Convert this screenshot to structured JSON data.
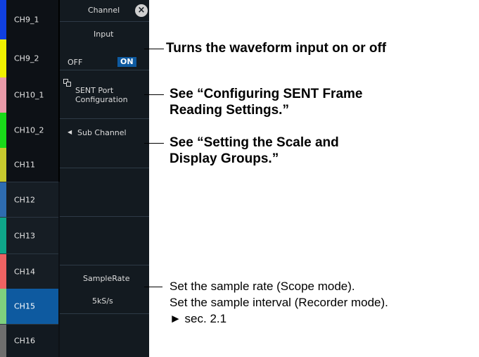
{
  "channels": [
    {
      "label": "CH9_1",
      "color": "#1040e0"
    },
    {
      "label": "CH9_2",
      "color": "#f0f000"
    },
    {
      "label": "CH10_1",
      "color": "#e89aa8"
    },
    {
      "label": "CH10_2",
      "color": "#19d919"
    },
    {
      "label": "CH11",
      "color": "#c6c82e"
    },
    {
      "label": "CH12",
      "color": "#2e6cb0"
    },
    {
      "label": "CH13",
      "color": "#0fa68a"
    },
    {
      "label": "CH14",
      "color": "#ee6262"
    },
    {
      "label": "CH15",
      "color": "#7ed07e"
    },
    {
      "label": "CH16",
      "color": "#6e6e6e"
    }
  ],
  "menu": {
    "title": "Channel",
    "input_label": "Input",
    "off_label": "OFF",
    "on_label": "ON",
    "sent_line1": "SENT Port",
    "sent_line2": "Configuration",
    "sub_channel": "Sub Channel",
    "sample_rate_label": "SampleRate",
    "sample_rate_value": "5kS/s"
  },
  "callouts": {
    "input": "Turns the waveform input on or off",
    "sent_line1": "See “Configuring SENT Frame",
    "sent_line2": "Reading Settings.”",
    "sub_line1": "See “Setting the Scale and",
    "sub_line2": "Display Groups.”",
    "rate_line1": "Set the sample rate (Scope mode).",
    "rate_line2": "Set the sample interval (Recorder mode).",
    "rate_line3": "► sec. 2.1"
  }
}
